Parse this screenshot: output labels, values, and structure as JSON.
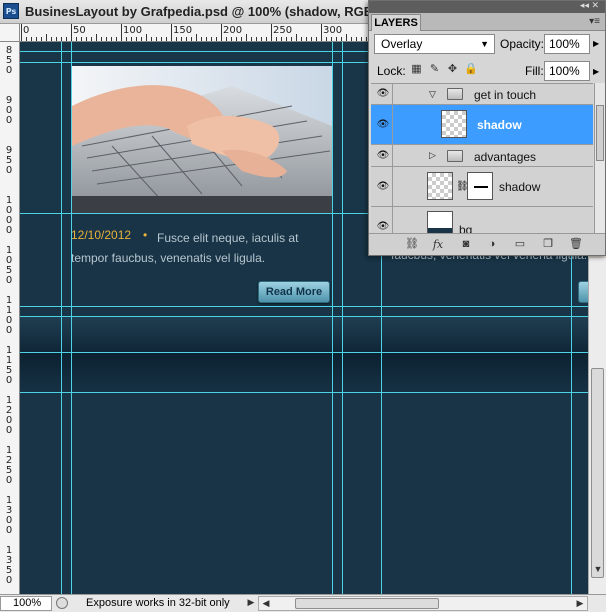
{
  "window": {
    "title": "BusinesLayout by Grafpedia.psd @ 100% (shadow, RGB/8) *",
    "app_icon": "Ps"
  },
  "ruler_top": {
    "labels": [
      "0",
      "50",
      "100",
      "150",
      "200",
      "250",
      "300"
    ]
  },
  "ruler_left": {
    "labels": [
      "8 5 0",
      "9 0 0",
      "9 5 0",
      "1 0 0 0",
      "1 0 5 0",
      "1 1 0 0",
      "1 1 5 0",
      "1 2 0 0",
      "1 2 5 0",
      "1 3 0 0",
      "1 3 5 0"
    ]
  },
  "canvas": {
    "post": {
      "date": "12/10/2012",
      "separator": "•",
      "excerpt": "Fusce elit neque, iaculis at tempor faucbus, venenatis vel ligula.",
      "button": "Read More"
    },
    "overlapped_text": "faucbus, venenatis vel venena ligula."
  },
  "layers_panel": {
    "tab": "LAYERS",
    "blend_mode": "Overlay",
    "opacity_label": "Opacity:",
    "opacity_value": "100%",
    "lock_label": "Lock:",
    "fill_label": "Fill:",
    "fill_value": "100%",
    "layers": [
      {
        "name": "get in touch",
        "type": "group",
        "expanded": true,
        "visible": true
      },
      {
        "name": "shadow",
        "type": "layer",
        "selected": true,
        "visible": true
      },
      {
        "name": "advantages",
        "type": "group",
        "expanded": false,
        "visible": true
      },
      {
        "name": "shadow",
        "type": "layer",
        "has_mask": true,
        "visible": true
      },
      {
        "name": "bg",
        "type": "layer",
        "visible": true
      }
    ]
  },
  "status": {
    "zoom": "100%",
    "message": "Exposure works in 32-bit only"
  },
  "colors": {
    "canvas_bg": "#183446",
    "guide": "#4dd2e6",
    "date": "#e9b23a",
    "selected_layer": "#3d9cff"
  }
}
